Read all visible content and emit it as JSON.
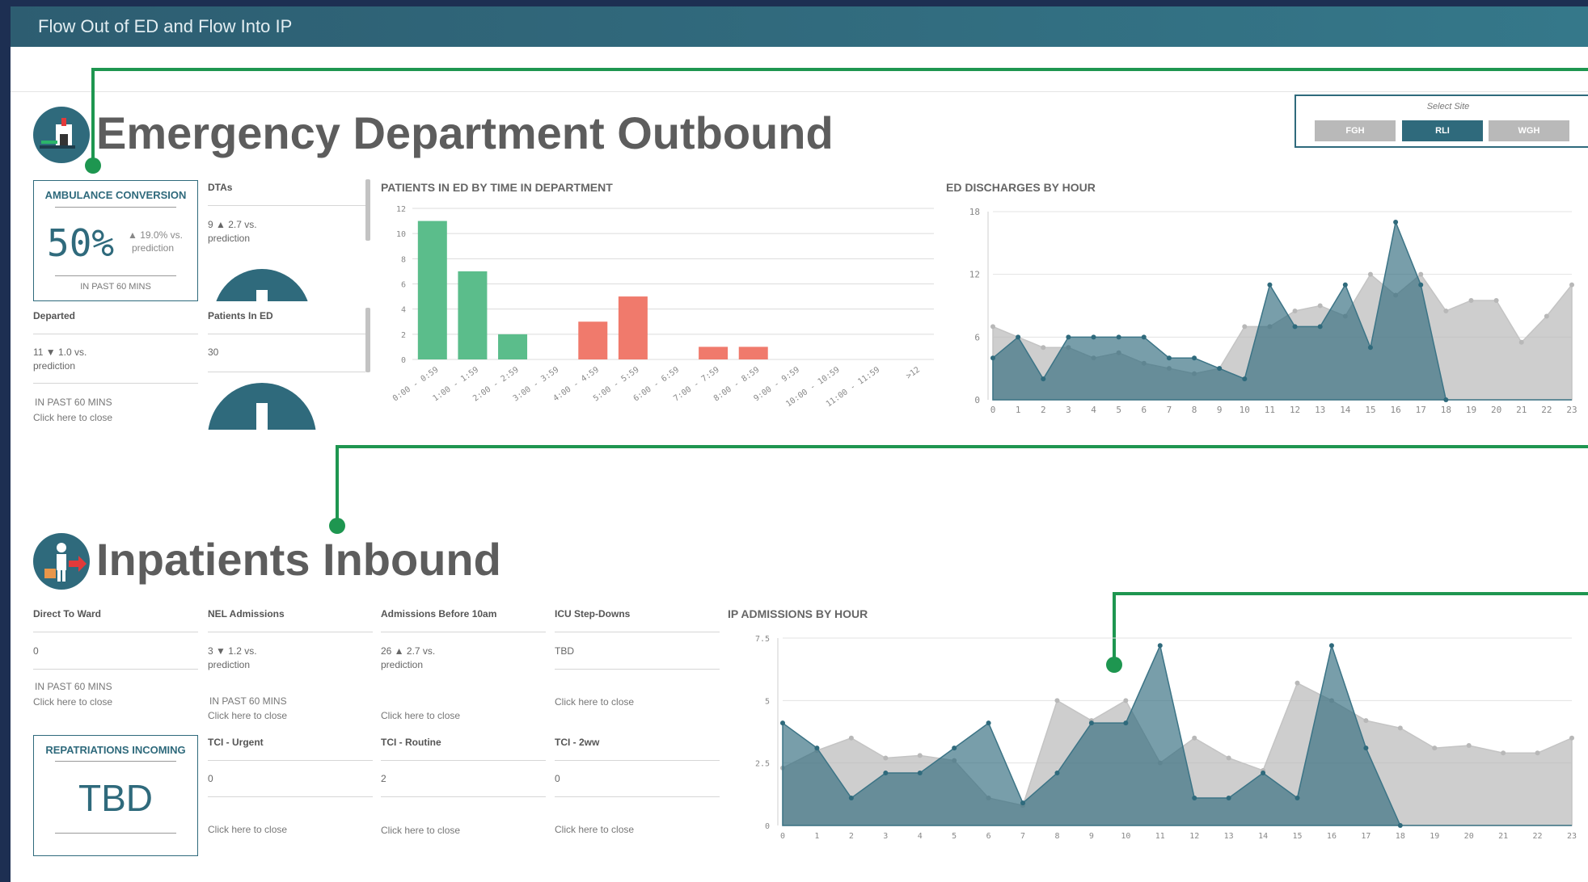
{
  "app": {
    "title": "Flow Out of ED and Flow Into IP"
  },
  "colors": {
    "green_connector": "#1e9650",
    "teal": "#2f6a7c",
    "bar_green": "#5bbd8b",
    "bar_red": "#f07a6c",
    "area_grey": "#bdbdbd"
  },
  "site_selector": {
    "label": "Select Site",
    "options": [
      "FGH",
      "RLI",
      "WGH"
    ],
    "selected": "RLI"
  },
  "ed": {
    "title": "Emergency Department Outbound",
    "icon": "emergency-department-icon",
    "ambulance": {
      "title": "AMBULANCE CONVERSION",
      "value": "50%",
      "delta": "▲ 19.0% vs.",
      "delta_sub": "prediction",
      "footer": "IN PAST 60 MINS"
    },
    "dtas": {
      "label": "DTAs",
      "value": "9 ▲ 2.7 vs.",
      "value_sub": "prediction"
    },
    "departed": {
      "label": "Departed",
      "value": "11 ▼ 1.0 vs.",
      "value_sub": "prediction",
      "footer": "IN PAST 60 MINS",
      "link": "Click here to close"
    },
    "patients_in_ed": {
      "label": "Patients In ED",
      "value": "30"
    }
  },
  "ip": {
    "title": "Inpatients Inbound",
    "icon": "inpatient-transfer-icon",
    "direct_to_ward": {
      "label": "Direct To Ward",
      "value": "0",
      "footer": "IN PAST 60 MINS",
      "link": "Click here to close"
    },
    "nel_admissions": {
      "label": "NEL Admissions",
      "value": "3 ▼ 1.2 vs.",
      "value_sub": "prediction",
      "footer": "IN PAST 60 MINS",
      "link": "Click here to close"
    },
    "admissions_before_10": {
      "label": "Admissions Before 10am",
      "value": "26 ▲ 2.7 vs.",
      "value_sub": "prediction",
      "link": "Click here to close"
    },
    "icu_stepdowns": {
      "label": "ICU Step-Downs",
      "value": "TBD",
      "link": "Click here to close"
    },
    "repatriations": {
      "title": "REPATRIATIONS INCOMING",
      "value": "TBD"
    },
    "tci_urgent": {
      "label": "TCI - Urgent",
      "value": "0",
      "link": "Click here to close"
    },
    "tci_routine": {
      "label": "TCI - Routine",
      "value": "2",
      "link": "Click here to close"
    },
    "tci_2ww": {
      "label": "TCI - 2ww",
      "value": "0",
      "link": "Click here to close"
    }
  },
  "chart_data": [
    {
      "id": "patients_by_time",
      "type": "bar",
      "title": "PATIENTS IN ED BY TIME IN DEPARTMENT",
      "categories": [
        "0:00 - 0:59",
        "1:00 - 1:59",
        "2:00 - 2:59",
        "3:00 - 3:59",
        "4:00 - 4:59",
        "5:00 - 5:59",
        "6:00 - 6:59",
        "7:00 - 7:59",
        "8:00 - 8:59",
        "9:00 - 9:59",
        "10:00 - 10:59",
        "11:00 - 11:59",
        ">12"
      ],
      "values": [
        11,
        7,
        2,
        0,
        3,
        5,
        0,
        1,
        1,
        0,
        0,
        0,
        0
      ],
      "colors": [
        "green",
        "green",
        "green",
        "green",
        "red",
        "red",
        "red",
        "red",
        "red",
        "red",
        "red",
        "red",
        "red"
      ],
      "yticks": [
        0,
        2,
        4,
        6,
        8,
        10,
        12
      ],
      "ylim": [
        0,
        12
      ]
    },
    {
      "id": "ed_discharges",
      "type": "area",
      "title": "ED DISCHARGES BY HOUR",
      "x": [
        0,
        1,
        2,
        3,
        4,
        5,
        6,
        7,
        8,
        9,
        10,
        11,
        12,
        13,
        14,
        15,
        16,
        17,
        18,
        19,
        20,
        21,
        22,
        23
      ],
      "series": [
        {
          "values": [
            7,
            6,
            5,
            5,
            4,
            4.5,
            3.5,
            3,
            2.5,
            3,
            7,
            7,
            8.5,
            9,
            8,
            12,
            10,
            12,
            8.5,
            9.5,
            9.5,
            5.5,
            8,
            11
          ]
        },
        {
          "values": [
            4,
            6,
            2,
            6,
            6,
            6,
            6,
            4,
            4,
            3,
            2,
            11,
            7,
            7,
            11,
            5,
            17,
            11,
            0,
            0,
            0,
            0,
            0,
            0
          ]
        }
      ],
      "yticks": [
        0,
        6,
        12,
        18
      ],
      "ylim": [
        0,
        18
      ]
    },
    {
      "id": "ip_admissions",
      "type": "area",
      "title": "IP ADMISSIONS BY HOUR",
      "x": [
        0,
        1,
        2,
        3,
        4,
        5,
        6,
        7,
        8,
        9,
        10,
        11,
        12,
        13,
        14,
        15,
        16,
        17,
        18,
        19,
        20,
        21,
        22,
        23
      ],
      "series": [
        {
          "values": [
            2.3,
            3,
            3.5,
            2.7,
            2.8,
            2.6,
            1.1,
            0.8,
            5,
            4.2,
            5,
            2.5,
            3.5,
            2.7,
            2.2,
            5.7,
            5,
            4.2,
            3.9,
            3.1,
            3.2,
            2.9,
            2.9,
            3.5
          ]
        },
        {
          "values": [
            4.1,
            3.1,
            1.1,
            2.1,
            2.1,
            3.1,
            4.1,
            0.9,
            2.1,
            4.1,
            4.1,
            7.2,
            1.1,
            1.1,
            2.1,
            1.1,
            7.2,
            3.1,
            0,
            0,
            0,
            0,
            0,
            0
          ]
        }
      ],
      "yticks": [
        "0",
        "2.5",
        "5",
        "7.5"
      ],
      "ylim": [
        0,
        7.5
      ]
    }
  ]
}
